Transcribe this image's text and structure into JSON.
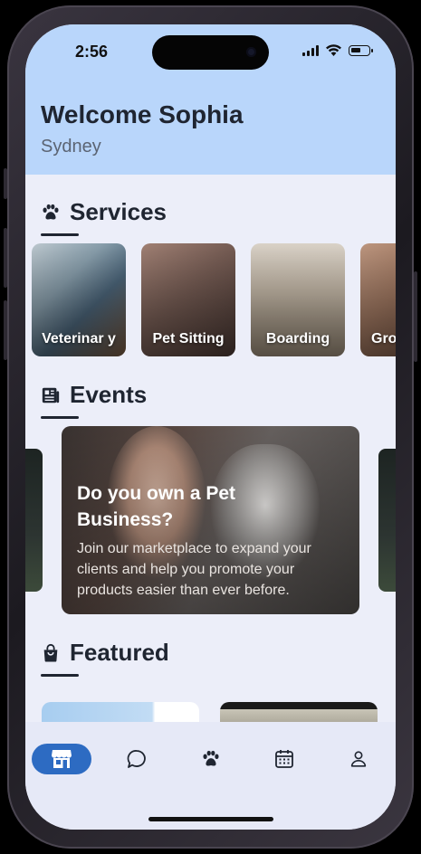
{
  "status_bar": {
    "time": "2:56"
  },
  "header": {
    "greeting": "Welcome Sophia",
    "location": "Sydney"
  },
  "services": {
    "title": "Services",
    "icon": "paw-icon",
    "items": [
      {
        "label": "Veterinar y"
      },
      {
        "label": "Pet Sitting"
      },
      {
        "label": "Boarding"
      },
      {
        "label": "Gro"
      }
    ]
  },
  "events": {
    "title": "Events",
    "icon": "newspaper-icon",
    "card": {
      "title": "Do you own a Pet Business?",
      "text": "Join our marketplace to expand your clients and help you promote your products easier than ever before."
    }
  },
  "featured": {
    "title": "Featured",
    "icon": "shopping-bag-icon"
  },
  "tabbar": {
    "active_color": "#2d6bc2",
    "items": [
      {
        "icon": "store-icon",
        "active": true
      },
      {
        "icon": "chat-icon",
        "active": false
      },
      {
        "icon": "paw-icon",
        "active": false
      },
      {
        "icon": "calendar-icon",
        "active": false
      },
      {
        "icon": "user-icon",
        "active": false
      }
    ]
  },
  "colors": {
    "header_bg": "#b9d6fb",
    "page_bg": "#eceef9",
    "text_dark": "#1f2531"
  }
}
